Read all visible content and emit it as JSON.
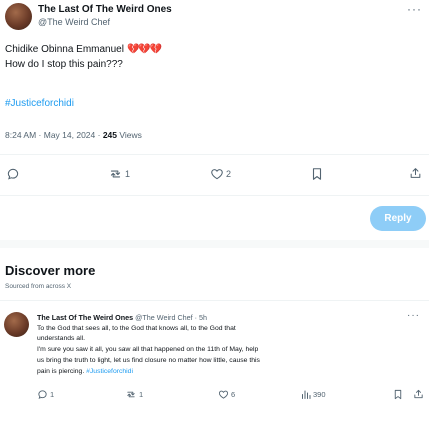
{
  "post": {
    "author_name": "The Last Of The Weird Ones",
    "author_handle": "@The Weird Chef",
    "more_label": "···",
    "line1": "Chidike Obinna Emmanuel",
    "line1_emoji": "💔💔💔",
    "line2": "How do I stop this pain???",
    "hashtag": "#Justiceforchidi",
    "time": "8:24 AM · May 14, 2024 · ",
    "views_count": "245",
    "views_label": " Views"
  },
  "actions": {
    "reply_count": "",
    "retweet_count": "1",
    "like_count": "2"
  },
  "reply_button_label": "Reply",
  "discover": {
    "title": "Discover more",
    "subtitle": "Sourced from across X"
  },
  "related": {
    "author_name": "The Last Of The Weird Ones",
    "author_handle": "@The Weird Chef",
    "age": " · 5h",
    "more_label": "···",
    "line1": "To the God that sees all, to the God that knows all, to the God that",
    "line2": "understands all.",
    "line3": "I'm sure you saw it all, you saw all that happened on the 11th of May, help",
    "line4": "us bring the truth to light, let us find closure no matter how little, cause this",
    "line5": "pain is piercing. ",
    "line5_tag": "#Justiceforchidi",
    "reply_count": "1",
    "retweet_count": "1",
    "like_count": "6",
    "views_count": "390"
  },
  "icons": {
    "reply": "reply-icon",
    "retweet": "retweet-icon",
    "like": "heart-icon",
    "bookmark": "bookmark-icon",
    "share": "share-icon",
    "views": "views-icon"
  },
  "colors": {
    "accent": "#1d9bf0",
    "reply_button_disabled": "#8ecdf7",
    "broken_heart": "#d4163a",
    "secondary_text": "#536471"
  }
}
